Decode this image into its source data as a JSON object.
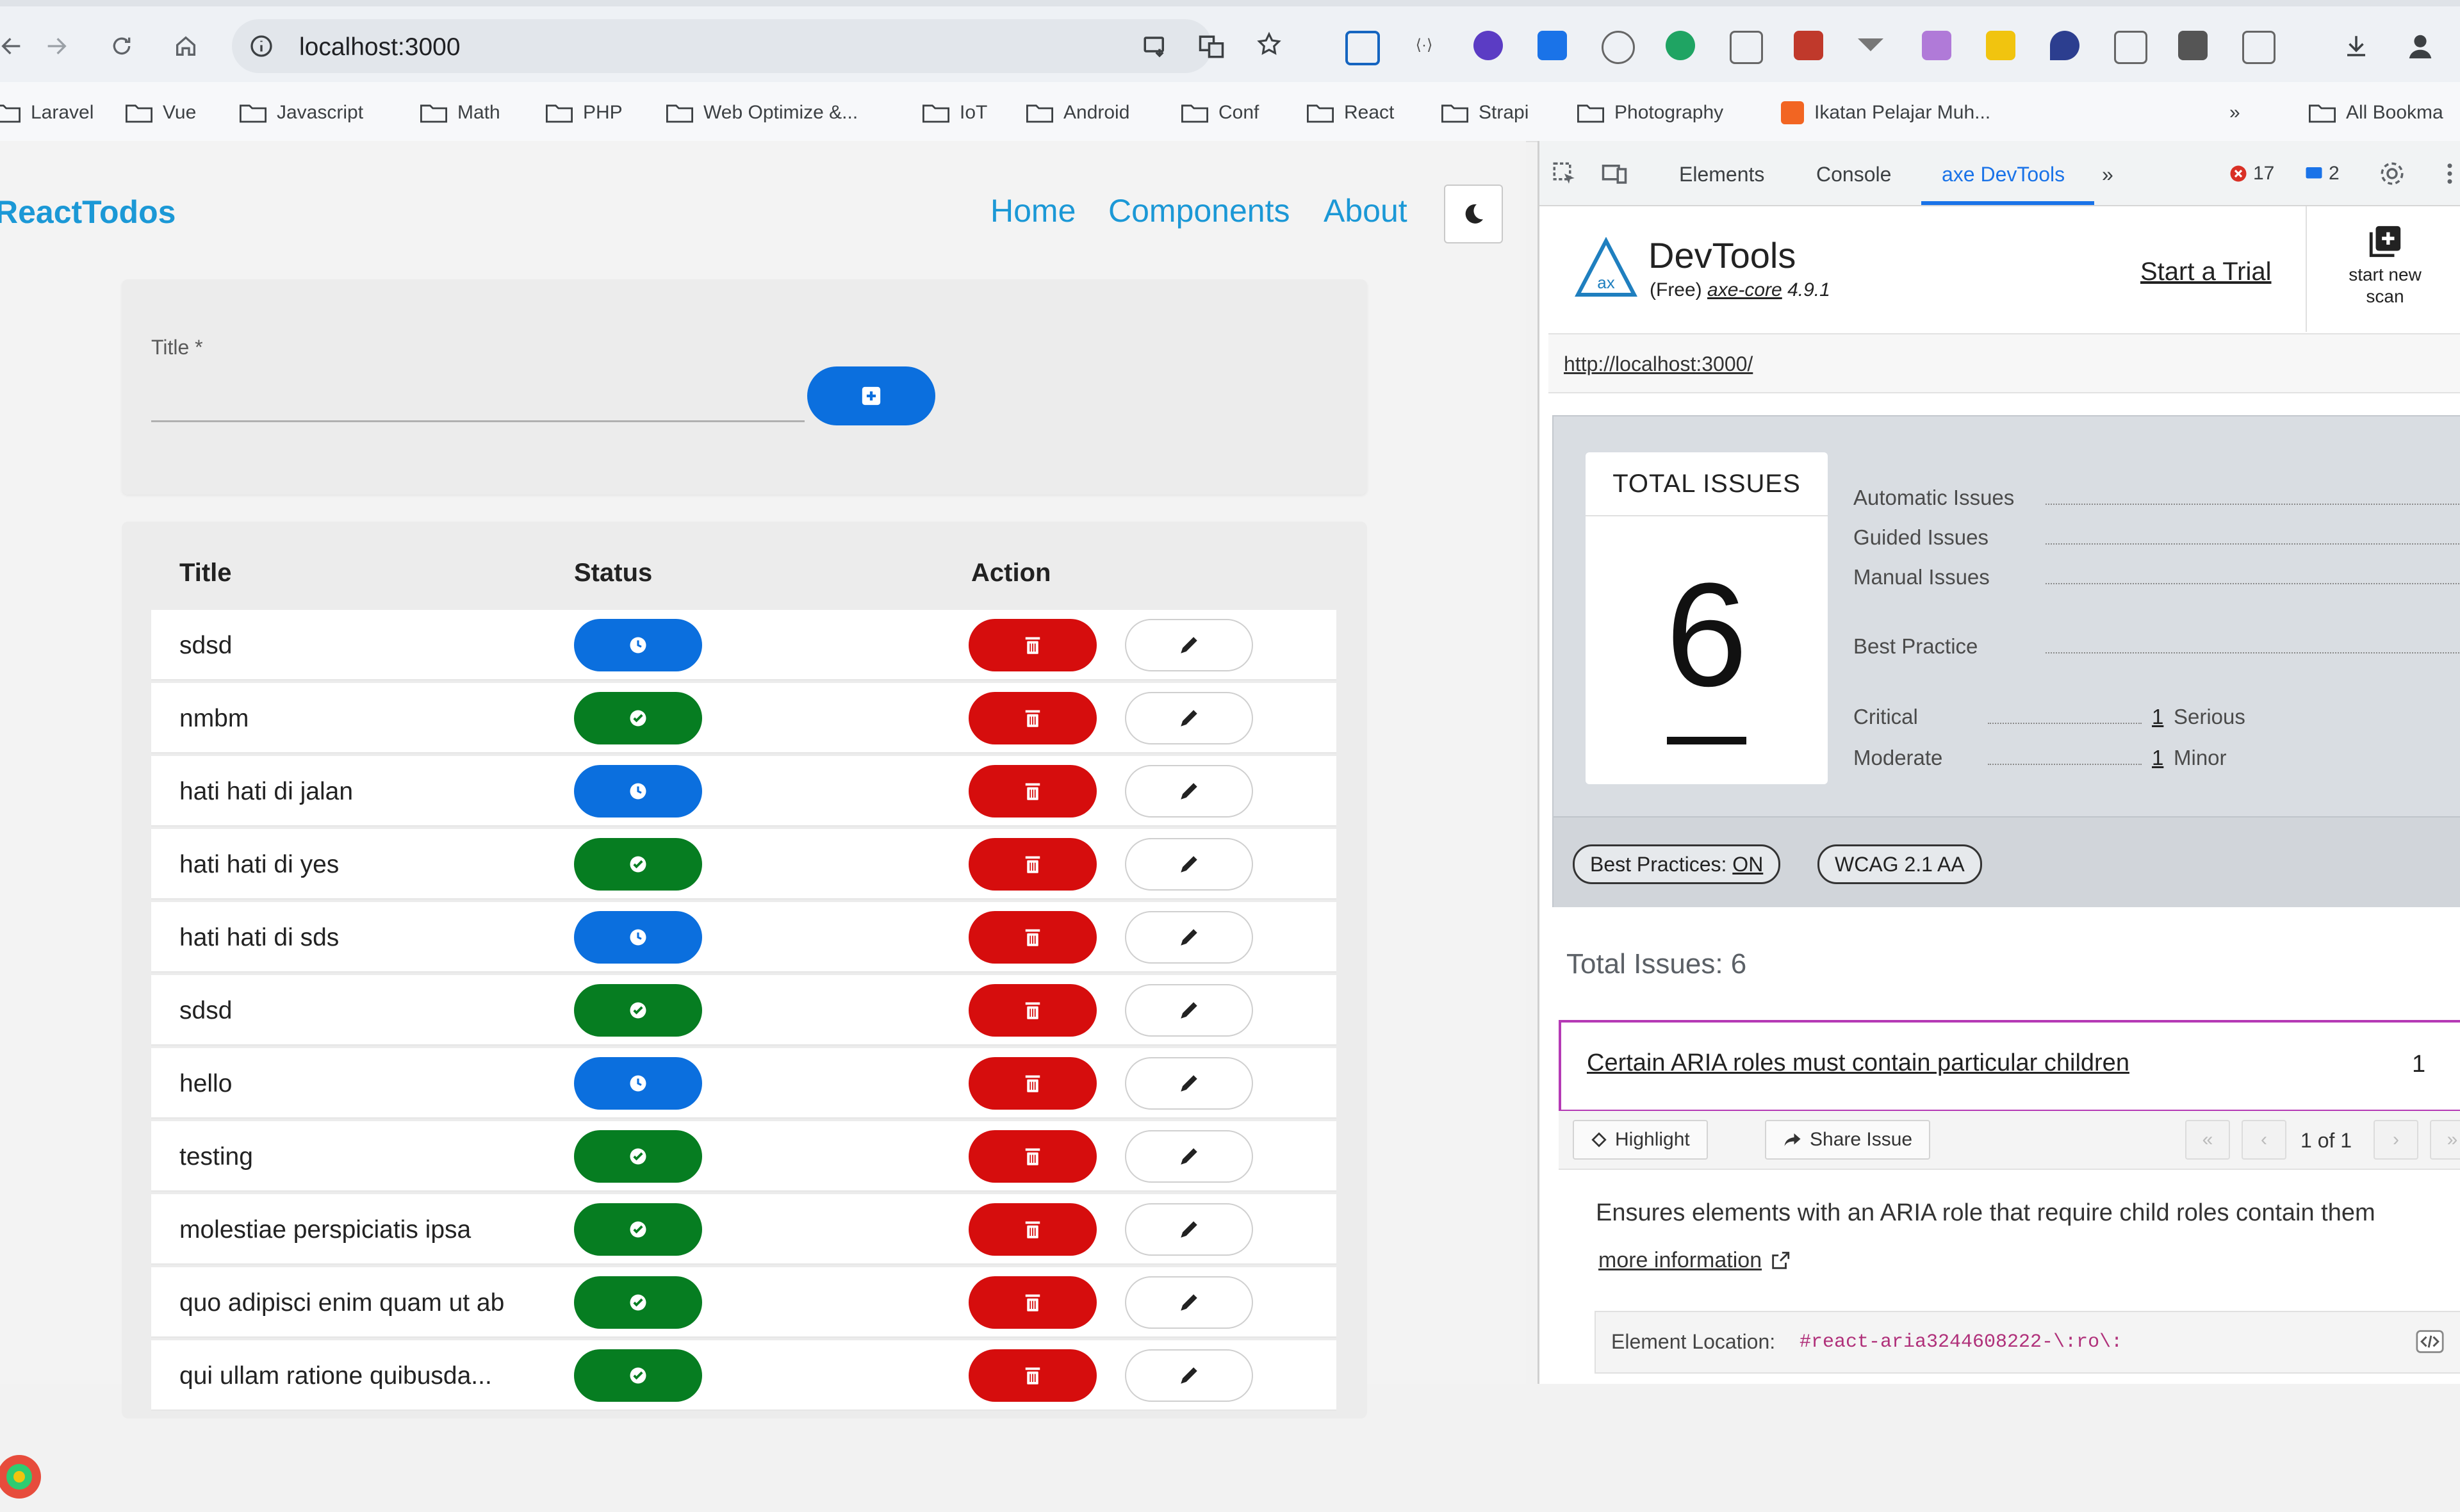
{
  "browser": {
    "url": "localhost:3000",
    "bookmarks": [
      "Laravel",
      "Vue",
      "Javascript",
      "Math",
      "PHP",
      "Web Optimize &...",
      "IoT",
      "Android",
      "Conf",
      "React",
      "Strapi",
      "Photography",
      "Ikatan Pelajar Muh...",
      "All Bookma"
    ]
  },
  "app": {
    "brand": "ReactTodos",
    "nav": [
      "Home",
      "Components",
      "About"
    ],
    "form": {
      "title_label": "Title *",
      "title_value": ""
    },
    "table": {
      "headers": [
        "Title",
        "Status",
        "Action"
      ],
      "rows": [
        {
          "title": "sdsd",
          "status": "pending"
        },
        {
          "title": "nmbm",
          "status": "done"
        },
        {
          "title": "hati hati di jalan",
          "status": "pending"
        },
        {
          "title": "hati hati di yes",
          "status": "done"
        },
        {
          "title": "hati hati di sds",
          "status": "pending"
        },
        {
          "title": "sdsd",
          "status": "done"
        },
        {
          "title": "hello",
          "status": "pending"
        },
        {
          "title": "testing",
          "status": "done"
        },
        {
          "title": "molestiae perspiciatis ipsa",
          "status": "done"
        },
        {
          "title": "quo adipisci enim quam ut ab",
          "status": "done"
        },
        {
          "title": "qui ullam ratione quibusda...",
          "status": "done"
        }
      ]
    },
    "colors": {
      "accent": "#1b98d6",
      "pending": "#0b6fde",
      "done": "#067d21",
      "delete": "#d60d0d"
    }
  },
  "devtools": {
    "tabs": [
      "Elements",
      "Console",
      "axe DevTools"
    ],
    "errors": "17",
    "messages": "2",
    "axe": {
      "title": "DevTools",
      "subtitle_prefix": "(Free)",
      "core_name": "axe-core",
      "core_version": "4.9.1",
      "start_trial": "Start a Trial",
      "new_scan_line1": "start new",
      "new_scan_line2": "scan",
      "scanned_url": "http://localhost:3000/",
      "total_label": "TOTAL ISSUES",
      "total": "6",
      "categories": [
        "Automatic Issues",
        "Guided Issues",
        "Manual Issues",
        "Best Practice"
      ],
      "severities": {
        "critical_label": "Critical",
        "critical": "1",
        "serious_label": "Serious",
        "moderate_label": "Moderate",
        "moderate": "1",
        "minor_label": "Minor"
      },
      "best_practices_label": "Best Practices:",
      "best_practices_state": "ON",
      "standard": "WCAG 2.1 AA",
      "issues_heading": "Total Issues: 6",
      "issue": {
        "title": "Certain ARIA roles must contain particular children",
        "count": "1",
        "highlight": "Highlight",
        "share": "Share Issue",
        "pager": "1 of 1",
        "description": "Ensures elements with an ARIA role that require child roles contain them",
        "more_info": "more information",
        "location_label": "Element Location:",
        "location_selector": "#react-aria3244608222-\\:ro\\:"
      }
    }
  }
}
